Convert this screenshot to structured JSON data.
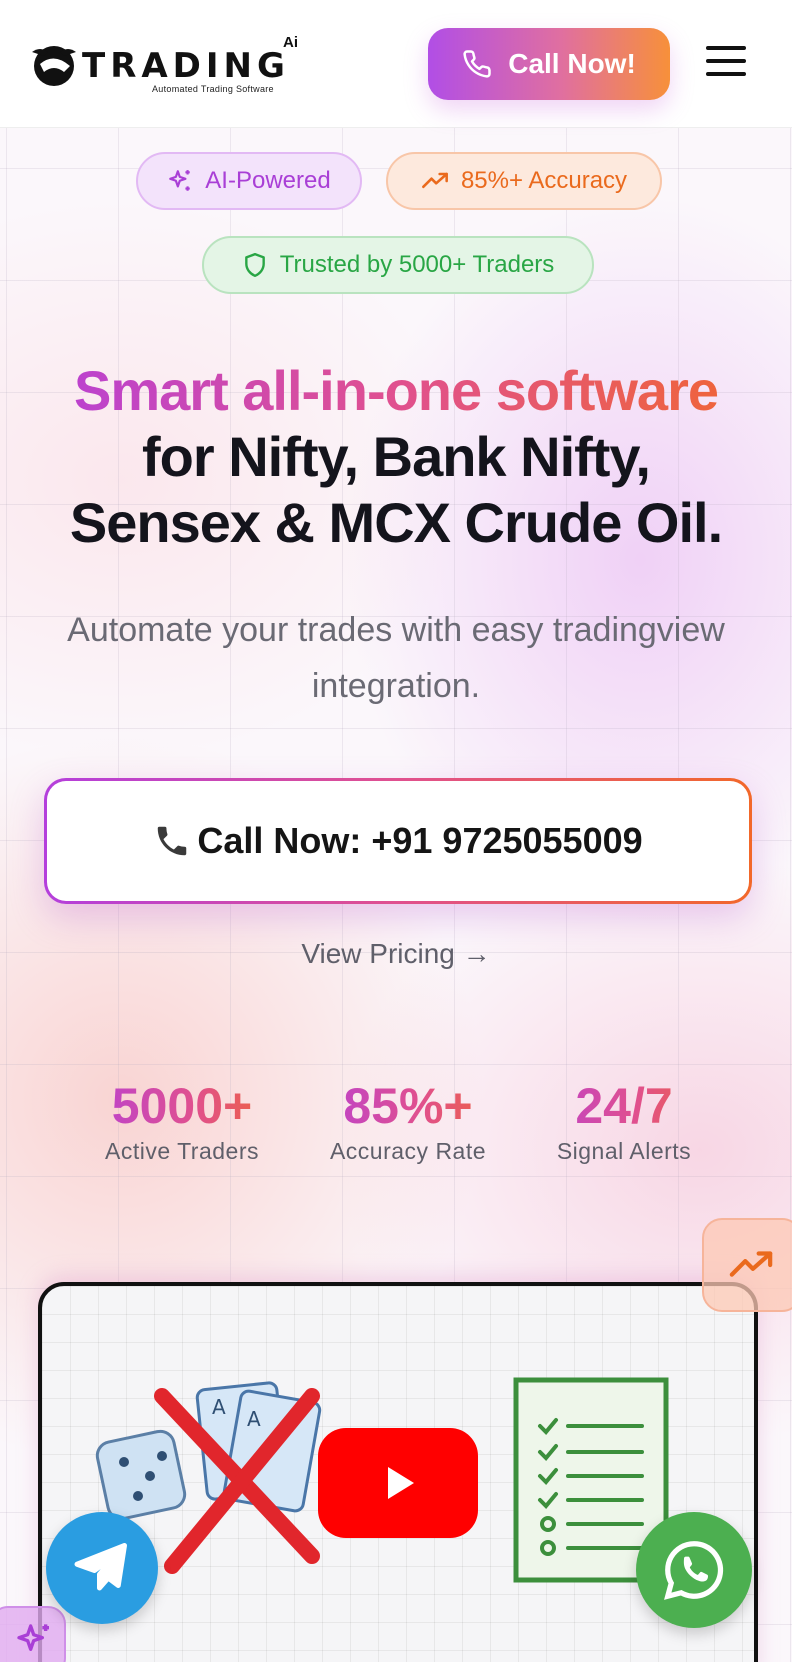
{
  "header": {
    "logo_text": "TRADING",
    "logo_ai": "Ai",
    "logo_tagline": "Automated Trading Software",
    "call_button_label": "Call Now!"
  },
  "badges": {
    "ai": "AI-Powered",
    "accuracy": "85%+ Accuracy",
    "trusted": "Trusted by 5000+ Traders"
  },
  "hero": {
    "headline_gradient": "Smart all-in-one software",
    "headline_line2": "for Nifty, Bank Nifty,",
    "headline_line3": "Sensex & MCX Crude Oil.",
    "subtext": "Automate your trades with easy tradingview integration.",
    "cta_label": "Call Now: +91 9725055009",
    "pricing_link": "View Pricing →"
  },
  "stats": [
    {
      "value": "5000+",
      "label": "Active Traders"
    },
    {
      "value": "85%+",
      "label": "Accuracy Rate"
    },
    {
      "value": "24/7",
      "label": "Signal Alerts"
    }
  ],
  "colors": {
    "gradient_start": "#b43fdc",
    "gradient_mid": "#e0508f",
    "gradient_end": "#f2682a",
    "youtube_red": "#ff0000",
    "telegram_blue": "#2a9de1",
    "whatsapp_green": "#4caf50"
  },
  "icons": {
    "header_call": "phone-icon",
    "menu": "hamburger-menu-icon",
    "badge_ai": "sparkles-icon",
    "badge_accuracy": "trending-up-icon",
    "badge_trusted": "shield-icon",
    "cta": "telephone-receiver-icon",
    "floating_trend": "trending-up-icon",
    "video_play": "youtube-play-icon",
    "telegram": "telegram-icon",
    "whatsapp": "whatsapp-icon"
  }
}
